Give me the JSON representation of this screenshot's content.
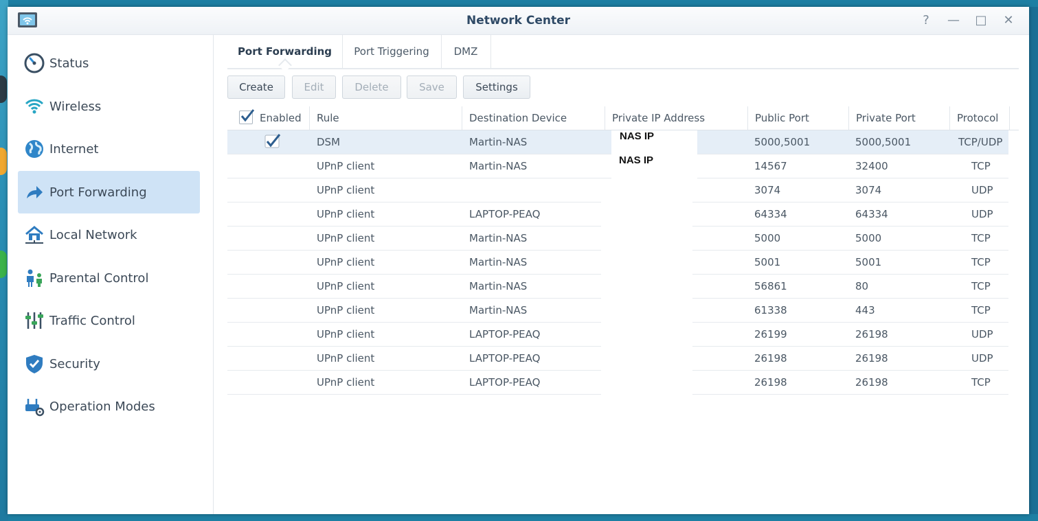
{
  "window": {
    "title": "Network Center",
    "help_glyph": "?",
    "minimize_glyph": "—",
    "maximize_glyph": "□",
    "close_glyph": "✕"
  },
  "sidebar": {
    "items": [
      {
        "label": "Status",
        "icon": "speedometer-icon"
      },
      {
        "label": "Wireless",
        "icon": "wifi-icon"
      },
      {
        "label": "Internet",
        "icon": "globe-icon"
      },
      {
        "label": "Port Forwarding",
        "icon": "forward-arrow-icon",
        "active": true
      },
      {
        "label": "Local Network",
        "icon": "home-network-icon"
      },
      {
        "label": "Parental Control",
        "icon": "family-icon"
      },
      {
        "label": "Traffic Control",
        "icon": "sliders-icon"
      },
      {
        "label": "Security",
        "icon": "shield-icon"
      },
      {
        "label": "Operation Modes",
        "icon": "router-gear-icon"
      }
    ]
  },
  "tabs": [
    {
      "label": "Port Forwarding",
      "active": true
    },
    {
      "label": "Port Triggering"
    },
    {
      "label": "DMZ"
    }
  ],
  "toolbar": {
    "create": "Create",
    "edit": "Edit",
    "delete": "Delete",
    "save": "Save",
    "settings": "Settings"
  },
  "table": {
    "headers": {
      "enabled": "Enabled",
      "rule": "Rule",
      "device": "Destination Device",
      "private_ip": "Private IP Address",
      "public_port": "Public Port",
      "private_port": "Private Port",
      "protocol": "Protocol"
    },
    "rows": [
      {
        "enabled": true,
        "rule": "DSM",
        "device": "Martin-NAS",
        "private_ip": "NAS IP",
        "public_port": "5000,5001",
        "private_port": "5000,5001",
        "protocol": "TCP/UDP",
        "selected": true
      },
      {
        "enabled": false,
        "rule": "UPnP client",
        "device": "Martin-NAS",
        "private_ip": "NAS IP",
        "public_port": "14567",
        "private_port": "32400",
        "protocol": "TCP"
      },
      {
        "enabled": false,
        "rule": "UPnP client",
        "device": "",
        "private_ip": "",
        "public_port": "3074",
        "private_port": "3074",
        "protocol": "UDP"
      },
      {
        "enabled": false,
        "rule": "UPnP client",
        "device": "LAPTOP-PEAQ",
        "private_ip": "",
        "public_port": "64334",
        "private_port": "64334",
        "protocol": "UDP"
      },
      {
        "enabled": false,
        "rule": "UPnP client",
        "device": "Martin-NAS",
        "private_ip": "",
        "public_port": "5000",
        "private_port": "5000",
        "protocol": "TCP"
      },
      {
        "enabled": false,
        "rule": "UPnP client",
        "device": "Martin-NAS",
        "private_ip": "",
        "public_port": "5001",
        "private_port": "5001",
        "protocol": "TCP"
      },
      {
        "enabled": false,
        "rule": "UPnP client",
        "device": "Martin-NAS",
        "private_ip": "",
        "public_port": "56861",
        "private_port": "80",
        "protocol": "TCP"
      },
      {
        "enabled": false,
        "rule": "UPnP client",
        "device": "Martin-NAS",
        "private_ip": "",
        "public_port": "61338",
        "private_port": "443",
        "protocol": "TCP"
      },
      {
        "enabled": false,
        "rule": "UPnP client",
        "device": "LAPTOP-PEAQ",
        "private_ip": "",
        "public_port": "26199",
        "private_port": "26198",
        "protocol": "UDP"
      },
      {
        "enabled": false,
        "rule": "UPnP client",
        "device": "LAPTOP-PEAQ",
        "private_ip": "",
        "public_port": "26198",
        "private_port": "26198",
        "protocol": "UDP"
      },
      {
        "enabled": false,
        "rule": "UPnP client",
        "device": "LAPTOP-PEAQ",
        "private_ip": "",
        "public_port": "26198",
        "private_port": "26198",
        "protocol": "TCP"
      }
    ]
  },
  "colors": {
    "accent": "#cfe3f6",
    "title": "#2f4a66",
    "selected_row": "#e5eef7",
    "check": "#2d5e8f"
  }
}
